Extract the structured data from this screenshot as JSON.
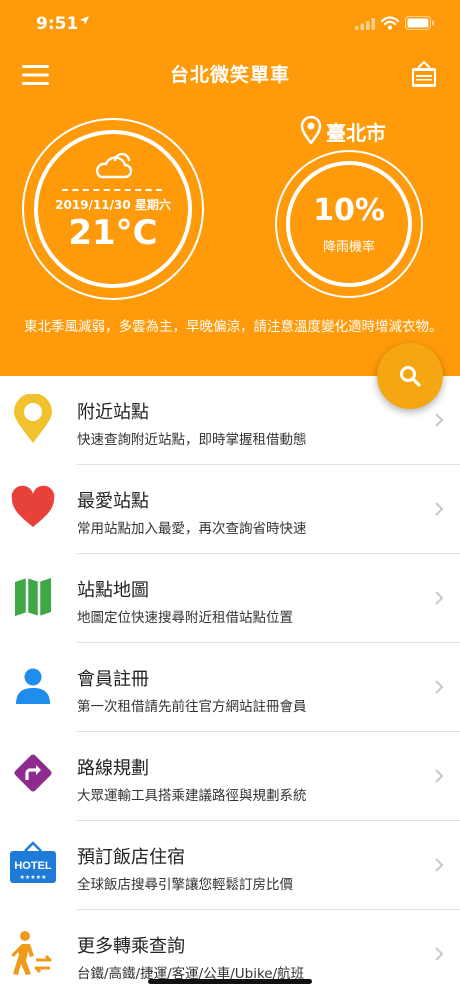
{
  "status_bar": {
    "time": "9:51"
  },
  "header": {
    "title": "台北微笑單車",
    "weather": {
      "date": "2019/11/30 星期六",
      "temperature": "21°C"
    },
    "location": {
      "city": "臺北市"
    },
    "rain": {
      "percentage": "10%",
      "label": "降雨機率"
    },
    "forecast": "東北季風減弱，多雲為主，早晚偏涼，請注意溫度變化適時增減衣物。"
  },
  "colors": {
    "header_bg": "#FF9A0A",
    "fab_bg": "#F4A712"
  },
  "menu": [
    {
      "title": "附近站點",
      "subtitle": "快速查詢附近站點，即時掌握租借動態",
      "icon": "location-pin-icon"
    },
    {
      "title": "最愛站點",
      "subtitle": "常用站點加入最愛，再次查詢省時快速",
      "icon": "heart-icon"
    },
    {
      "title": "站點地圖",
      "subtitle": "地圖定位快速搜尋附近租借站點位置",
      "icon": "map-icon"
    },
    {
      "title": "會員註冊",
      "subtitle": "第一次租借請先前往官方網站註冊會員",
      "icon": "user-icon"
    },
    {
      "title": "路線規劃",
      "subtitle": "大眾運輸工具搭乘建議路徑與規劃系統",
      "icon": "route-sign-icon"
    },
    {
      "title": "預訂飯店住宿",
      "subtitle": "全球飯店搜尋引擎讓您輕鬆訂房比價",
      "icon": "hotel-sign-icon",
      "icon_text": "HOTEL"
    },
    {
      "title": "更多轉乘查詢",
      "subtitle": "台鐵/高鐵/捷運/客運/公車/Ubike/航班",
      "icon": "transfer-walker-icon"
    }
  ]
}
